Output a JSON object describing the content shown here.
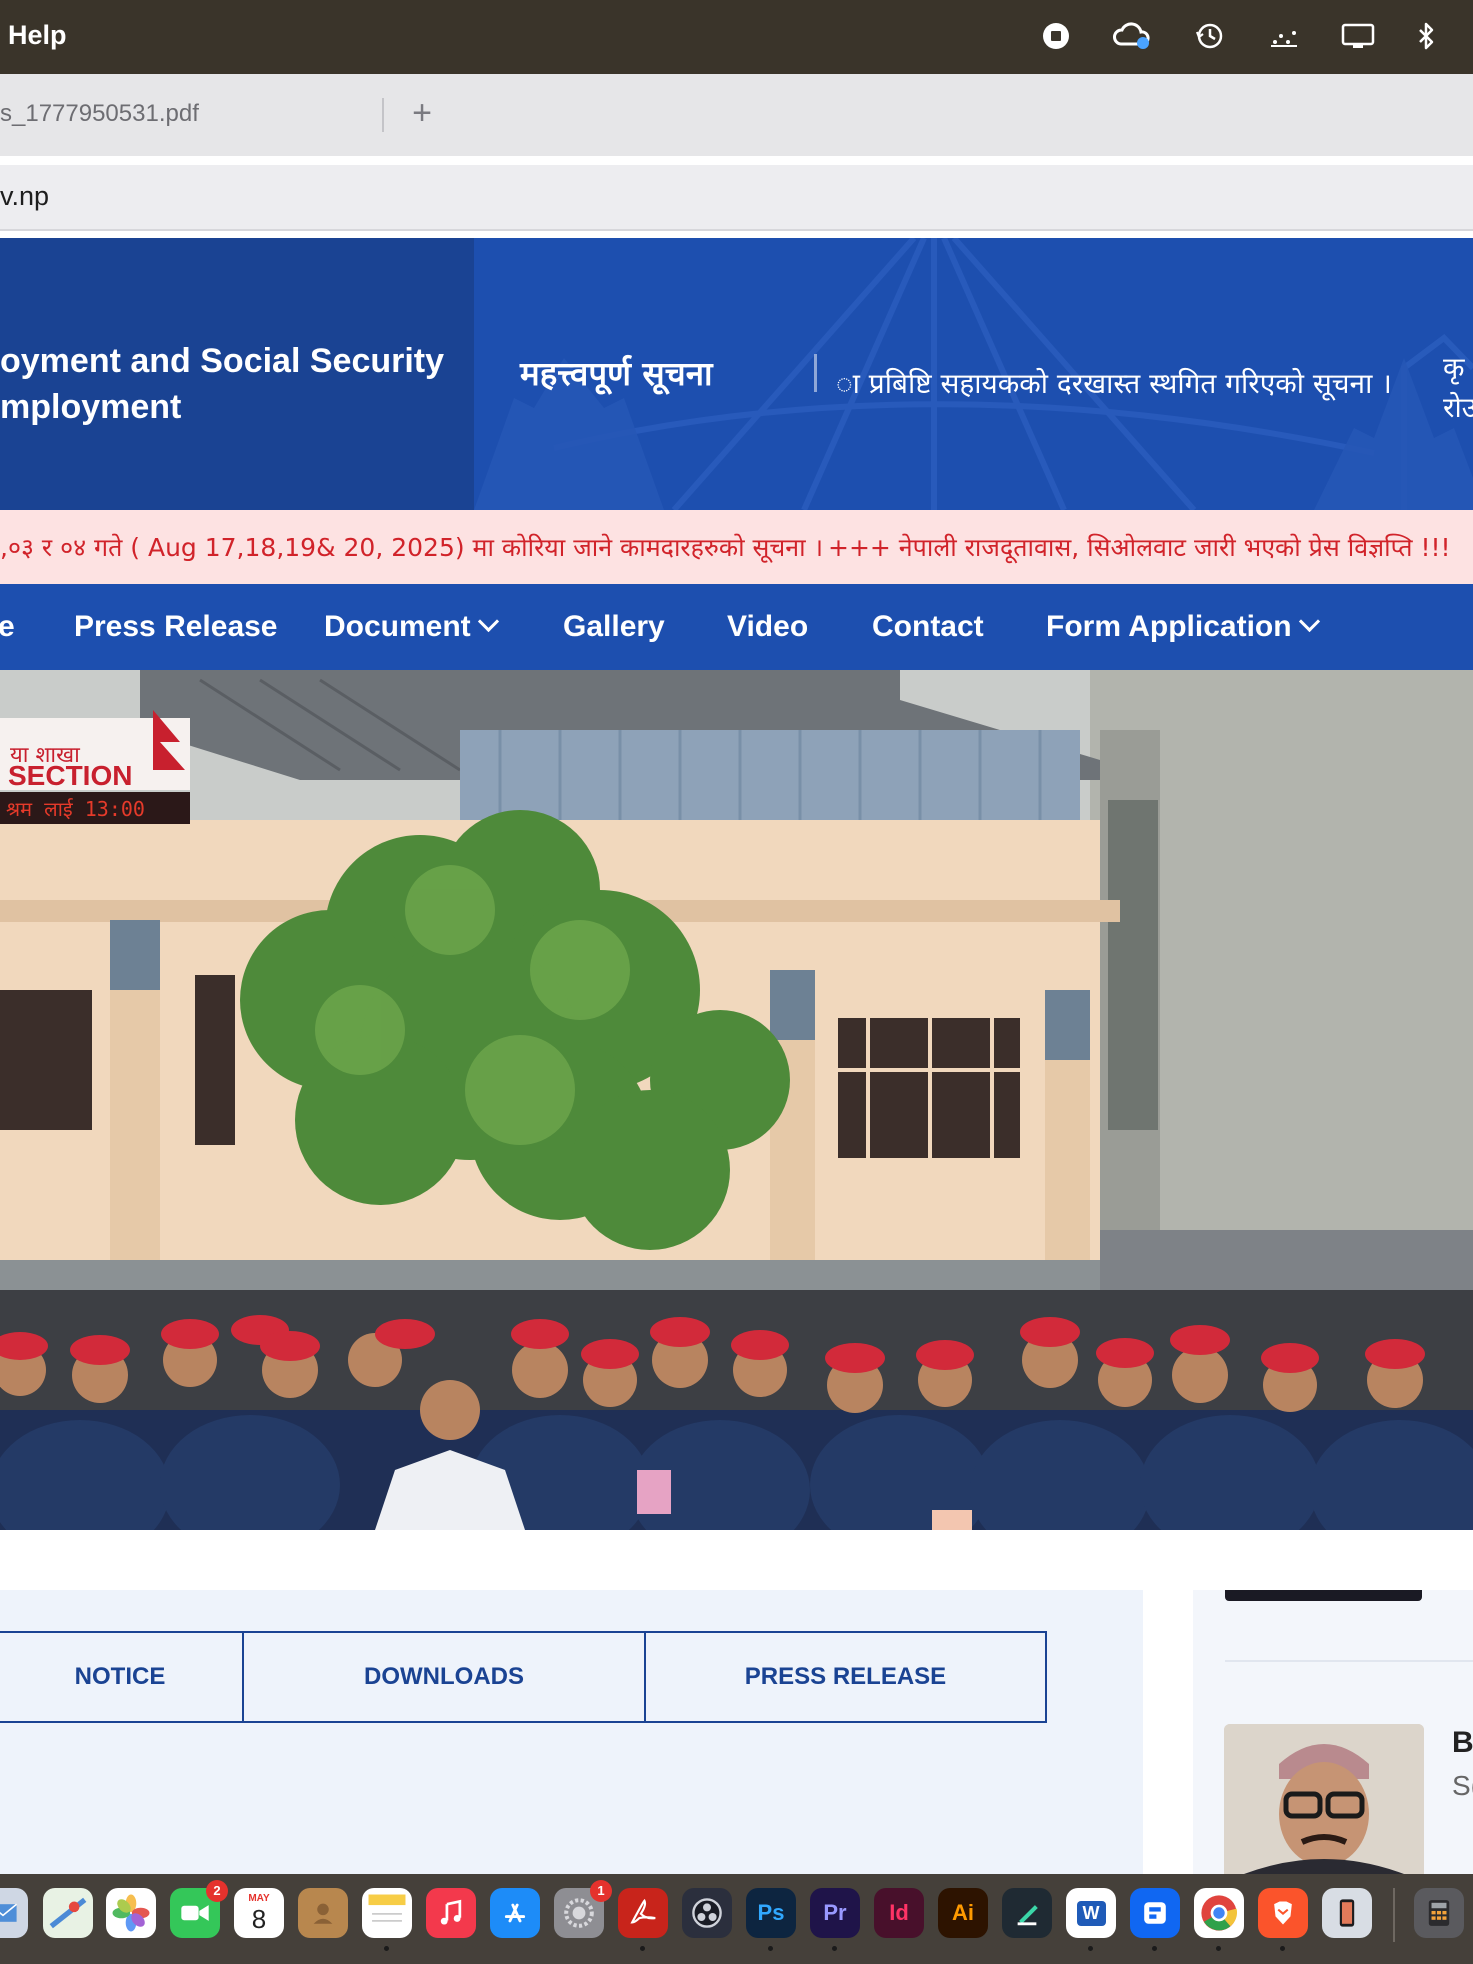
{
  "menubar": {
    "menu_help": "Help",
    "tray_icons": [
      "stop-record-icon",
      "creative-cloud-icon",
      "time-machine-icon",
      "control-dots-icon",
      "display-icon",
      "bluetooth-icon"
    ]
  },
  "browser": {
    "tab_title": "s_1777950531.pdf",
    "new_tab_label": "+",
    "url": "v.np"
  },
  "site": {
    "ministry_line1": "oyment and Social Security",
    "ministry_line2": "mployment",
    "notice_label": "महत्त्वपूर्ण सूचना",
    "notice_text": "ा प्रबिष्टि सहायकको दरखास्त स्थगित गरिएको सूचना ।",
    "notice_cut_line1": "कृ",
    "notice_cut_line2": "रोउ",
    "marquee_1": ",०३ र ०४ गते ( Aug 17,18,19& 20, 2025) मा कोरिया जाने कामदारहरुको सूचना ।",
    "marquee_2": "+++ नेपाली राजदूतावास, सिओलवाट जारी भएको प्रेस विज्ञप्ति !!!"
  },
  "nav": {
    "items": [
      {
        "label": "e"
      },
      {
        "label": "Press Release"
      },
      {
        "label": "Document"
      },
      {
        "label": "Gallery"
      },
      {
        "label": "Video"
      },
      {
        "label": "Contact"
      },
      {
        "label": "Form Application"
      }
    ]
  },
  "hero": {
    "sign_line1": "या शाखा",
    "sign_line2": "SECTION",
    "led_text": "श्रम लाई 13:00"
  },
  "content": {
    "tabs": [
      {
        "label": "NOTICE"
      },
      {
        "label": "DOWNLOADS"
      },
      {
        "label": "PRESS RELEASE"
      }
    ],
    "profile_name_cut": "B",
    "profile_role_cut": "S("
  },
  "dock": {
    "facetime_badge": "2",
    "calendar_month": "MAY",
    "calendar_day": "8",
    "settings_badge": "1",
    "labels": {
      "ps": "Ps",
      "pr": "Pr",
      "id": "Id",
      "ai": "Ai",
      "word": "W"
    }
  },
  "colors": {
    "header_blue": "#1d4faf",
    "header_left_blue": "#1a4393",
    "marquee_bg": "#fde2e2",
    "marquee_text": "#d1232a",
    "menubar": "#3a342a"
  }
}
